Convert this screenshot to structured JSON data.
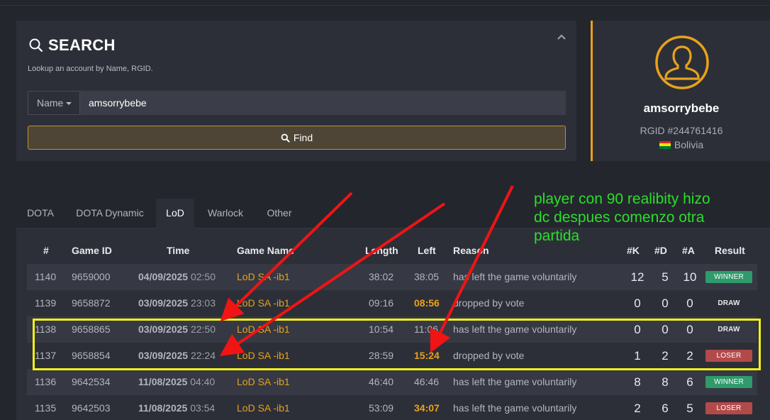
{
  "search": {
    "title": "SEARCH",
    "subtitle": "Lookup an account by Name, RGID.",
    "field_type": "Name",
    "query": "amsorrybebe",
    "find_label": "Find"
  },
  "profile": {
    "name": "amsorrybebe",
    "rgid": "RGID #244761416",
    "country": "Bolivia"
  },
  "tabs": [
    {
      "label": "DOTA"
    },
    {
      "label": "DOTA Dynamic"
    },
    {
      "label": "LoD",
      "active": true
    },
    {
      "label": "Warlock"
    },
    {
      "label": "Other"
    }
  ],
  "table": {
    "headers": {
      "num": "#",
      "game_id": "Game ID",
      "time": "Time",
      "game_name": "Game Name",
      "length": "Length",
      "left": "Left",
      "reason": "Reason",
      "k": "#K",
      "d": "#D",
      "a": "#A",
      "result": "Result"
    },
    "rows": [
      {
        "num": "1140",
        "game_id": "9659000",
        "date": "04/09/2025",
        "clock": "02:50",
        "game_name": "LoD SA -ib1",
        "length": "38:02",
        "left": "38:05",
        "left_hl": false,
        "reason": "has left the game voluntarily",
        "k": "12",
        "d": "5",
        "a": "10",
        "result": "WINNER"
      },
      {
        "num": "1139",
        "game_id": "9658872",
        "date": "03/09/2025",
        "clock": "23:03",
        "game_name": "LoD SA -ib1",
        "length": "09:16",
        "left": "08:56",
        "left_hl": true,
        "reason": "dropped by vote",
        "k": "0",
        "d": "0",
        "a": "0",
        "result": "DRAW"
      },
      {
        "num": "1138",
        "game_id": "9658865",
        "date": "03/09/2025",
        "clock": "22:50",
        "game_name": "LoD SA -ib1",
        "length": "10:54",
        "left": "11:06",
        "left_hl": false,
        "reason": "has left the game voluntarily",
        "k": "0",
        "d": "0",
        "a": "0",
        "result": "DRAW"
      },
      {
        "num": "1137",
        "game_id": "9658854",
        "date": "03/09/2025",
        "clock": "22:24",
        "game_name": "LoD SA -ib1",
        "length": "28:59",
        "left": "15:24",
        "left_hl": true,
        "reason": "dropped by vote",
        "k": "1",
        "d": "2",
        "a": "2",
        "result": "LOSER"
      },
      {
        "num": "1136",
        "game_id": "9642534",
        "date": "11/08/2025",
        "clock": "04:40",
        "game_name": "LoD SA -ib1",
        "length": "46:40",
        "left": "46:46",
        "left_hl": false,
        "reason": "has left the game voluntarily",
        "k": "8",
        "d": "8",
        "a": "6",
        "result": "WINNER"
      },
      {
        "num": "1135",
        "game_id": "9642503",
        "date": "11/08/2025",
        "clock": "03:54",
        "game_name": "LoD SA -ib1",
        "length": "53:09",
        "left": "34:07",
        "left_hl": true,
        "reason": "has left the game voluntarily",
        "k": "2",
        "d": "6",
        "a": "5",
        "result": "LOSER"
      }
    ]
  },
  "annotation": {
    "text_line1": "player con 90 realibity hizo",
    "text_line2": "dc despues comenzo otra",
    "text_line3": "partida"
  },
  "colors": {
    "accent": "#e8a21a",
    "winner": "#2f9a6c",
    "loser": "#b34a4a",
    "annotation_text": "#2adf2a",
    "arrow": "#f01414",
    "highlight_box": "#f2f01a"
  }
}
